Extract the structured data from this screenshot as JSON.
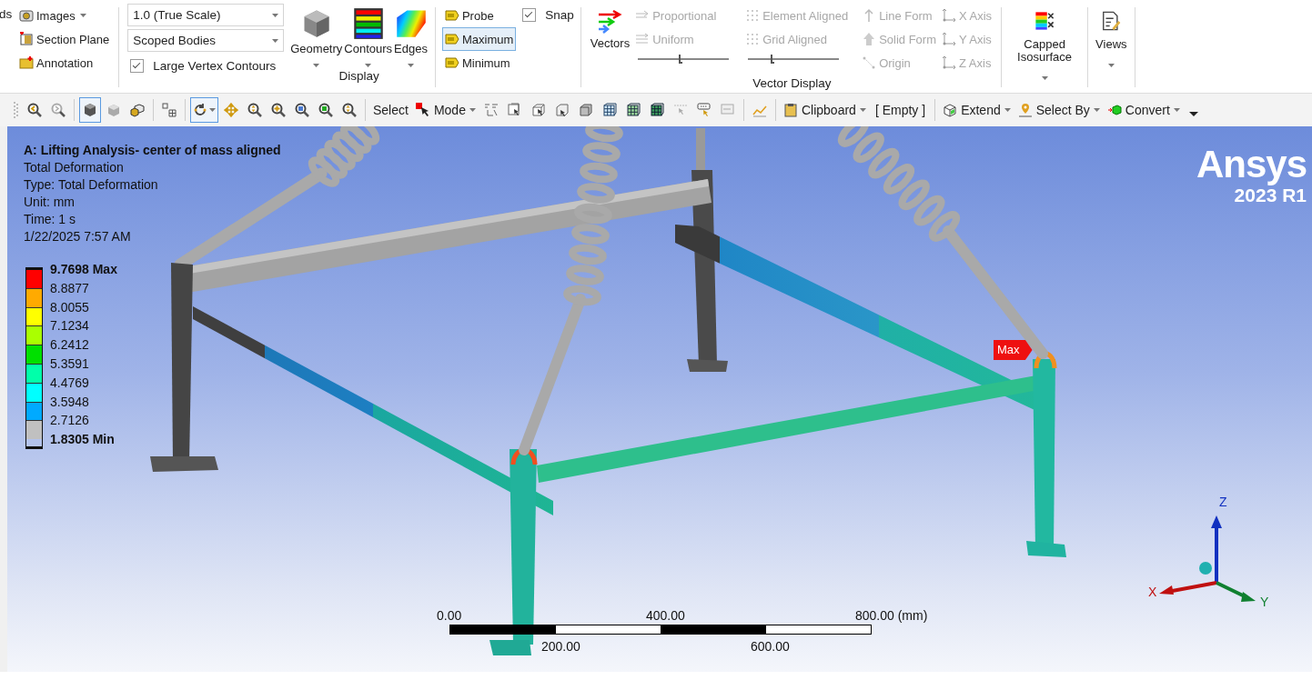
{
  "ribbon": {
    "cut_label": "ds",
    "image_tools": [
      {
        "label": "Images",
        "dropdown": true
      },
      {
        "label": "Section Plane",
        "dropdown": false
      },
      {
        "label": "Annotation",
        "dropdown": false
      }
    ],
    "display": {
      "scale_select": "1.0 (True Scale)",
      "body_select": "Scoped Bodies",
      "vertex_contours": {
        "label": "Large Vertex Contours",
        "checked": true
      },
      "buttons": [
        {
          "label": "Geometry",
          "dropdown": true
        },
        {
          "label": "Contours",
          "dropdown": true
        },
        {
          "label": "Edges",
          "dropdown": true
        }
      ],
      "label": "Display"
    },
    "probe_tools": [
      {
        "label": "Probe",
        "selected": false
      },
      {
        "label": "Maximum",
        "selected": true
      },
      {
        "label": "Minimum",
        "selected": false
      }
    ],
    "snap": {
      "label": "Snap",
      "checked": true
    },
    "vector_display": {
      "vectors": "Vectors",
      "scaling": [
        {
          "label": "Proportional",
          "disabled": true
        },
        {
          "label": "Uniform",
          "disabled": true
        }
      ],
      "scale_slider": {
        "level": 0.45
      },
      "alignment": [
        {
          "label": "Element Aligned",
          "disabled": true
        },
        {
          "label": "Grid Aligned",
          "disabled": true
        }
      ],
      "density_slider": {
        "level": 0.25
      },
      "forms": [
        {
          "label": "Line Form",
          "disabled": true
        },
        {
          "label": "Solid Form",
          "disabled": true
        },
        {
          "label": "Origin",
          "disabled": true
        }
      ],
      "axes": [
        {
          "label": "X Axis",
          "disabled": true
        },
        {
          "label": "Y Axis",
          "disabled": true
        },
        {
          "label": "Z Axis",
          "disabled": true
        }
      ],
      "label": "Vector Display"
    },
    "capped_isosurface": {
      "label": "Capped Isosurface",
      "dropdown": true
    },
    "views": {
      "label": "Views",
      "dropdown": true
    }
  },
  "toolbar": {
    "groups": [
      [
        {
          "kind": "icon",
          "selected": false
        },
        {
          "kind": "icon",
          "selected": false
        }
      ],
      [
        {
          "kind": "icon",
          "selected": true
        },
        {
          "kind": "icon",
          "selected": false
        },
        {
          "kind": "icon",
          "selected": false
        }
      ],
      [
        {
          "kind": "icon",
          "selected": false
        }
      ],
      [
        {
          "kind": "icon",
          "selected": true,
          "dropdown": true
        },
        {
          "kind": "icon",
          "selected": false
        },
        {
          "kind": "icon",
          "selected": false
        },
        {
          "kind": "icon",
          "selected": false
        },
        {
          "kind": "icon",
          "selected": false
        },
        {
          "kind": "icon",
          "selected": false
        },
        {
          "kind": "icon",
          "selected": false
        }
      ],
      [
        {
          "kind": "button",
          "label": "Select"
        },
        {
          "kind": "menu",
          "label": "Mode"
        },
        {
          "kind": "icon",
          "selected": false
        },
        {
          "kind": "icon",
          "selected": false
        },
        {
          "kind": "icon",
          "selected": false
        },
        {
          "kind": "icon",
          "selected": false
        },
        {
          "kind": "icon",
          "selected": false
        },
        {
          "kind": "icon",
          "selected": false
        },
        {
          "kind": "icon",
          "selected": false
        },
        {
          "kind": "icon",
          "selected": false
        },
        {
          "kind": "icon",
          "selected": false
        },
        {
          "kind": "icon",
          "selected": false
        },
        {
          "kind": "icon",
          "selected": false
        }
      ],
      [
        {
          "kind": "icon",
          "selected": false
        }
      ],
      [
        {
          "kind": "menu",
          "label": "Clipboard"
        },
        {
          "kind": "text",
          "label": "[ Empty ]"
        }
      ],
      [
        {
          "kind": "menu",
          "label": "Extend"
        },
        {
          "kind": "menu",
          "label": "Select By"
        },
        {
          "kind": "menu",
          "label": "Convert"
        }
      ]
    ]
  },
  "viewport": {
    "info": {
      "title": "A: Lifting Analysis- center of mass aligned",
      "lines": [
        "Total Deformation",
        "Type: Total Deformation",
        "Unit: mm",
        "Time: 1 s",
        "1/22/2025 7:57 AM"
      ]
    },
    "legend": {
      "labels": [
        {
          "kind": "max",
          "text": "9.7698 Max"
        },
        {
          "kind": "value",
          "text": "8.8877"
        },
        {
          "kind": "value",
          "text": "8.0055"
        },
        {
          "kind": "value",
          "text": "7.1234"
        },
        {
          "kind": "value",
          "text": "6.2412"
        },
        {
          "kind": "value",
          "text": "5.3591"
        },
        {
          "kind": "value",
          "text": "4.4769"
        },
        {
          "kind": "value",
          "text": "3.5948"
        },
        {
          "kind": "value",
          "text": "2.7126"
        },
        {
          "kind": "min",
          "text": "1.8305 Min"
        }
      ],
      "bands": [
        {
          "color": "#ff0000"
        },
        {
          "color": "#ffaa00"
        },
        {
          "color": "#ffff00"
        },
        {
          "color": "#aaff00"
        },
        {
          "color": "#00e000"
        },
        {
          "color": "#00ffaa"
        },
        {
          "color": "#00ffff"
        },
        {
          "color": "#00aaff"
        },
        {
          "color": "#c0c0c0"
        }
      ]
    },
    "brand": {
      "name": "Ansys",
      "version": "2023 R1"
    },
    "probe_label": "Max",
    "scale": {
      "top_labels": [
        "0.00",
        "400.00",
        "800.00 (mm)"
      ],
      "bottom_labels": [
        "200.00",
        "600.00"
      ]
    },
    "triad": {
      "x": "X",
      "y": "Y",
      "z": "Z"
    }
  }
}
